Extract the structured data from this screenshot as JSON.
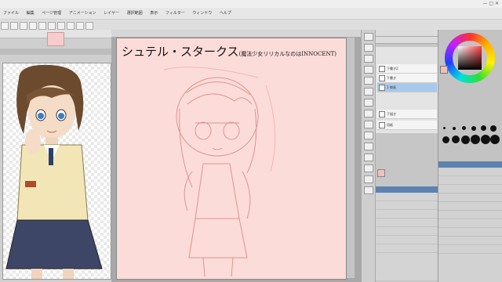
{
  "window": {
    "title": "",
    "controls": "— □ ✕"
  },
  "menu": [
    "ファイル",
    "編集",
    "ページ管理",
    "アニメーション",
    "レイヤー",
    "選択範囲",
    "表示",
    "フィルター",
    "ウィンドウ",
    "ヘルプ"
  ],
  "canvas": {
    "title_main": "シュテル・スタークス",
    "title_sub": "(魔法少女リリカルなのはINNOCENT)"
  },
  "layers": [
    {
      "label": "下書き2",
      "selected": false
    },
    {
      "label": "下書き",
      "selected": false
    },
    {
      "label": "1 線画",
      "selected": true
    },
    {
      "label": "下描き",
      "selected": false
    },
    {
      "label": "用紙",
      "selected": false
    }
  ],
  "colors": {
    "main": "#f0c0bb",
    "paper": "#fcdcd8",
    "accent": "#5e82b0"
  }
}
